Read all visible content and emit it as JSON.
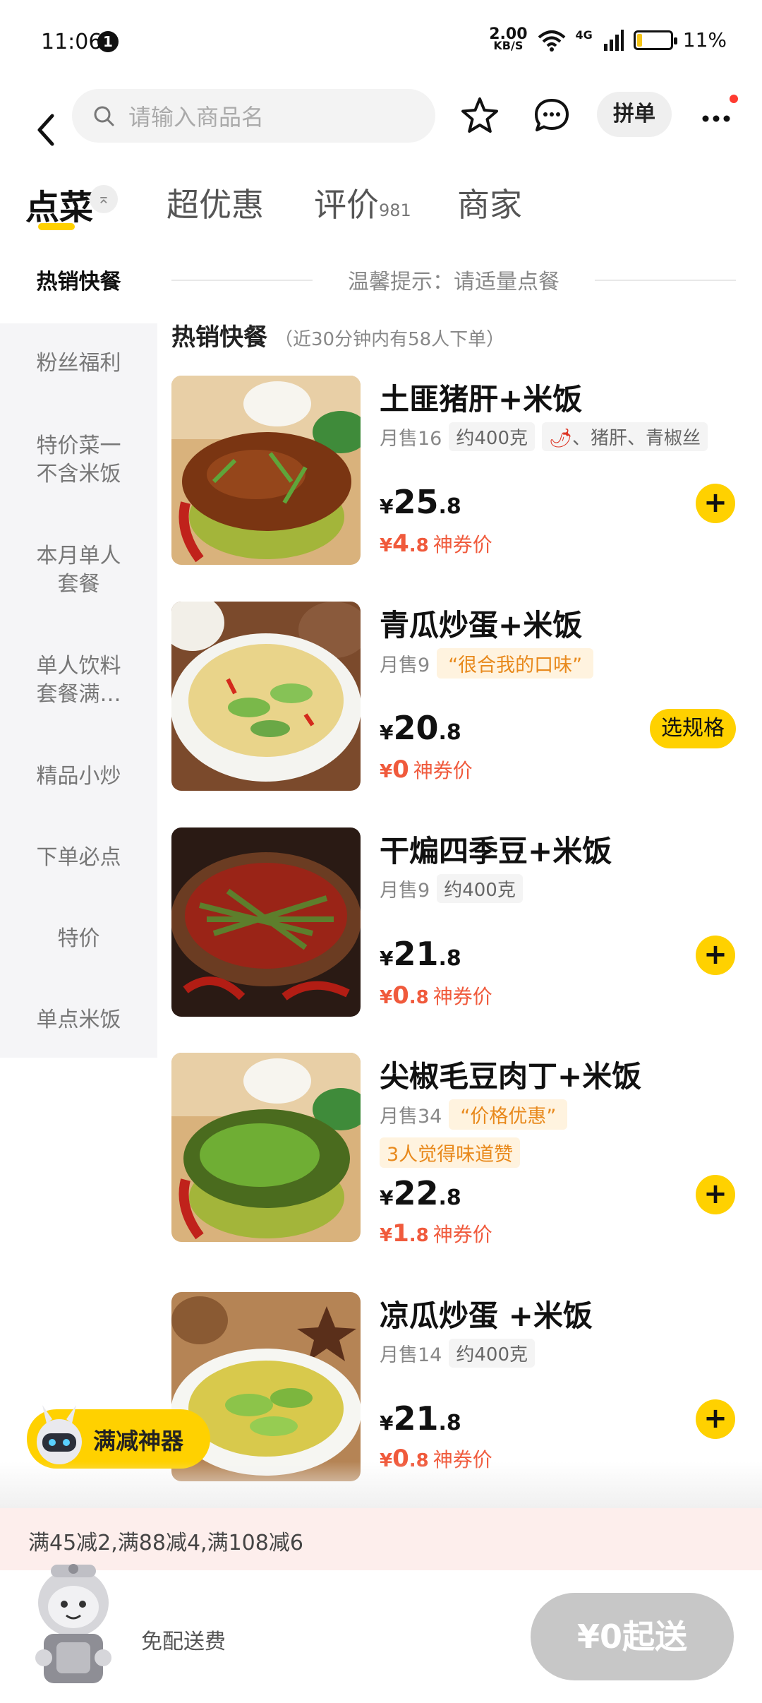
{
  "status_bar": {
    "time": "11:06",
    "notification_count": "1",
    "net_speed_value": "2.00",
    "net_speed_unit": "KB/S",
    "network": "4G",
    "battery": "11%"
  },
  "header": {
    "search_placeholder": "请输入商品名",
    "group_button": "拼单"
  },
  "tabs": [
    {
      "label": "点菜"
    },
    {
      "label": "超优惠"
    },
    {
      "label": "评价",
      "count": "981"
    },
    {
      "label": "商家"
    }
  ],
  "sidebar": {
    "items": [
      {
        "label": "热销快餐"
      },
      {
        "label": "粉丝福利"
      },
      {
        "label": "特价菜一\n不含米饭"
      },
      {
        "label": "本月单人\n套餐"
      },
      {
        "label": "单人饮料\n套餐满…"
      },
      {
        "label": "精品小炒"
      },
      {
        "label": "下单必点"
      },
      {
        "label": "特价"
      },
      {
        "label": "单点米饭"
      }
    ]
  },
  "tip": "温馨提示：请适量点餐",
  "section": {
    "title": "热销快餐",
    "subtitle": "（近30分钟内有58人下单）"
  },
  "items": [
    {
      "name": "土匪猪肝+米饭",
      "sales": "月售16",
      "chip": "约400克",
      "tags": "、猪肝、青椒丝",
      "price_int": "25",
      "price_dec": ".8",
      "coupon_int": "4",
      "coupon_dec": ".8",
      "coupon_label": "神券价",
      "action": "+"
    },
    {
      "name": "青瓜炒蛋+米饭",
      "sales": "月售9",
      "quote": "“很合我的口味”",
      "price_int": "20",
      "price_dec": ".8",
      "coupon_int": "0",
      "coupon_dec": "",
      "coupon_label": "神券价",
      "action": "选规格"
    },
    {
      "name": "干煸四季豆+米饭",
      "sales": "月售9",
      "chip": "约400克",
      "price_int": "21",
      "price_dec": ".8",
      "coupon_int": "0",
      "coupon_dec": ".8",
      "coupon_label": "神券价",
      "action": "+"
    },
    {
      "name": "尖椒毛豆肉丁+米饭",
      "sales": "月售34",
      "quote": "“价格优惠”",
      "praise": "3人觉得味道赞",
      "price_int": "22",
      "price_dec": ".8",
      "coupon_int": "1",
      "coupon_dec": ".8",
      "coupon_label": "神券价",
      "action": "+"
    },
    {
      "name": "凉瓜炒蛋 +米饭",
      "sales": "月售14",
      "chip": "约400克",
      "price_int": "21",
      "price_dec": ".8",
      "coupon_int": "0",
      "coupon_dec": ".8",
      "coupon_label": "神券价",
      "action": "+"
    }
  ],
  "currency": "¥",
  "fab_label": "满减神器",
  "promo": "满45减2,满88减4,满108减6",
  "cart": {
    "delivery": "免配送费",
    "button": "¥0起送"
  },
  "colors": {
    "accent": "#ffd100",
    "price_red": "#f05a3c",
    "quote_orange": "#e8891c"
  }
}
